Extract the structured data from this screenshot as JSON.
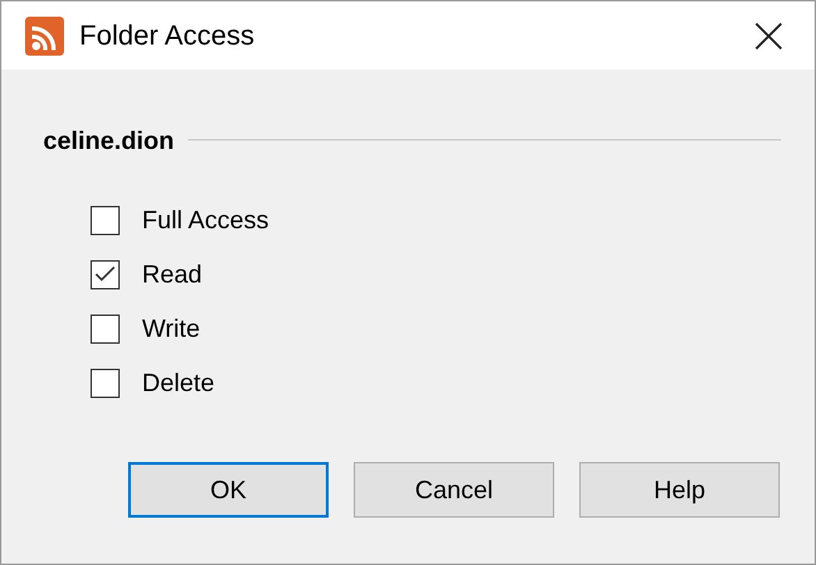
{
  "window": {
    "title": "Folder Access"
  },
  "group": {
    "title": "celine.dion"
  },
  "permissions": [
    {
      "label": "Full Access",
      "checked": false
    },
    {
      "label": "Read",
      "checked": true
    },
    {
      "label": "Write",
      "checked": false
    },
    {
      "label": "Delete",
      "checked": false
    }
  ],
  "buttons": [
    {
      "label": "OK",
      "default": true
    },
    {
      "label": "Cancel",
      "default": false
    },
    {
      "label": "Help",
      "default": false
    }
  ]
}
